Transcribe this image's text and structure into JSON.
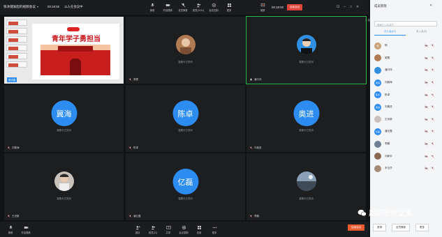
{
  "header": {
    "meeting_title": "张沐捷发起的视频会议",
    "timer": "00:18:50",
    "online_count": "11人在会议中",
    "tools": [
      {
        "label": "静音",
        "icon": "mic-icon"
      },
      {
        "label": "开启视频",
        "icon": "camera-icon"
      },
      {
        "label": "全员静音",
        "icon": "mute-all-icon"
      },
      {
        "label": "成员(11/11)",
        "icon": "members-icon"
      },
      {
        "label": "会议控制",
        "icon": "controls-icon"
      },
      {
        "label": "更多",
        "icon": "more-icon"
      }
    ],
    "record_label": "录屏",
    "record_timer": "00:18:50",
    "end_label": "结束会议",
    "fullscreen_label": "全屏"
  },
  "tiles": [
    {
      "type": "slide",
      "slide_title": "青年学子勇担当",
      "name": "张沐捷"
    },
    {
      "type": "photo",
      "name": "周蕾",
      "status": "摄像头已关闭",
      "photo_color": "#b07a52"
    },
    {
      "type": "photo",
      "name": "潘行伟",
      "status": "摄像头已关闭",
      "photo_color": "#2f8fe0",
      "active": true
    },
    {
      "type": "text",
      "avatar": "冀海",
      "name": "刘冀海",
      "status": "摄像头已关闭"
    },
    {
      "type": "text",
      "avatar": "陈卓",
      "name": "陈卓",
      "status": "摄像头已关闭"
    },
    {
      "type": "text",
      "avatar": "奥进",
      "name": "刘奥进",
      "status": "摄像头已关闭"
    },
    {
      "type": "photo",
      "name": "王世新",
      "status": "摄像头已关闭",
      "photo_color": "#c9c2ba"
    },
    {
      "type": "text",
      "avatar": "亿磊",
      "name": "潘亿磊",
      "status": "摄像头已关闭"
    },
    {
      "type": "photo",
      "name": "李鹏",
      "status": "摄像头已关闭",
      "photo_color": "#6d7f92"
    }
  ],
  "footer": {
    "left_tools": [
      {
        "label": "静音",
        "icon": "mic-icon"
      },
      {
        "label": "开启视频",
        "icon": "camera-icon"
      }
    ],
    "center_tools": [
      {
        "label": "邀请",
        "icon": "invite-icon"
      },
      {
        "label": "成员(11)",
        "icon": "members-icon"
      },
      {
        "label": "共享",
        "icon": "share-icon"
      },
      {
        "label": "会议录制",
        "icon": "record-icon"
      },
      {
        "label": "应用",
        "icon": "apps-icon"
      },
      {
        "label": "更多",
        "icon": "more-icon"
      }
    ],
    "invite_label": "结束会议"
  },
  "panel": {
    "title": "成员管理",
    "search_placeholder": "搜索已入会成员",
    "tabs": [
      "已入会(11)",
      "未入会(0)"
    ],
    "members": [
      {
        "avatar": "杨",
        "name": "杨",
        "avatar_color": "#c9a27a"
      },
      {
        "avatar": "",
        "name": "周蕾",
        "avatar_color": "#b07a52"
      },
      {
        "avatar": "",
        "name": "潘行伟",
        "avatar_color": "#2f8fe0"
      },
      {
        "avatar": "冀海",
        "name": "刘冀海",
        "avatar_color": "#2d8cf0"
      },
      {
        "avatar": "陈卓",
        "name": "陈卓",
        "avatar_color": "#2d8cf0"
      },
      {
        "avatar": "奥进",
        "name": "刘奥进",
        "avatar_color": "#2d8cf0"
      },
      {
        "avatar": "",
        "name": "王世新",
        "avatar_color": "#c9c2ba"
      },
      {
        "avatar": "亿磊",
        "name": "潘亿磊",
        "avatar_color": "#2d8cf0"
      },
      {
        "avatar": "",
        "name": "李鹏",
        "avatar_color": "#6d7f92"
      },
      {
        "avatar": "",
        "name": "刘新宇",
        "avatar_color": "#8a6a55"
      },
      {
        "avatar": "",
        "name": "尹玉莎",
        "avatar_color": "#a58a78"
      }
    ],
    "buttons": [
      "邀请",
      "全员静音",
      "更多"
    ]
  },
  "watermark": "周职农牧之家"
}
